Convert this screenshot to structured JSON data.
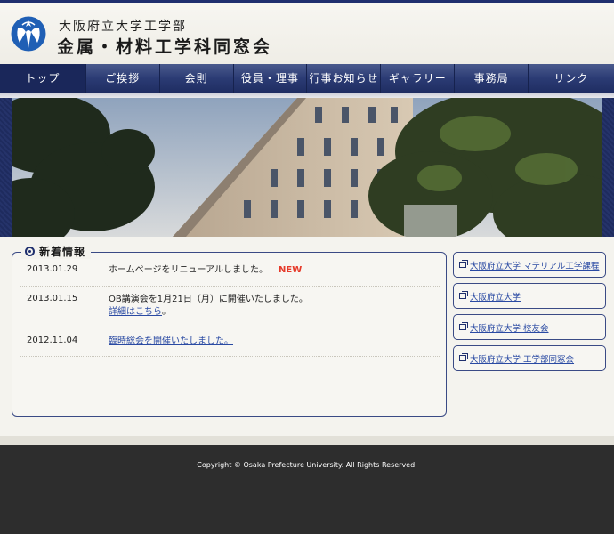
{
  "header": {
    "university": "大阪府立大学工学部",
    "title": "金属・材料工学科同窓会"
  },
  "nav": {
    "items": [
      {
        "label": "トップ"
      },
      {
        "label": "ご挨拶"
      },
      {
        "label": "会則"
      },
      {
        "label": "役員・理事"
      },
      {
        "label": "行事お知らせ"
      },
      {
        "label": "ギャラリー"
      },
      {
        "label": "事務局"
      },
      {
        "label": "リンク"
      }
    ]
  },
  "news": {
    "heading": "新着情報",
    "items": [
      {
        "date": "2013.01.29",
        "text": "ホームページをリニューアルしました。",
        "badge": "NEW"
      },
      {
        "date": "2013.01.15",
        "text": "OB講演会を1月21日（月）に開催いたしました。",
        "link": "詳細はこちら",
        "suffix": "。"
      },
      {
        "date": "2012.11.04",
        "link": "臨時総会を開催いたしました。"
      }
    ]
  },
  "side_links": [
    {
      "label": "大阪府立大学 マテリアル工学課程"
    },
    {
      "label": "大阪府立大学"
    },
    {
      "label": "大阪府立大学 校友会"
    },
    {
      "label": "大阪府立大学 工学部同窓会"
    }
  ],
  "footer": {
    "copyright": "Copyright © Osaka Prefecture University. All Rights Reserved."
  },
  "colors": {
    "brand_navy": "#1f2f6e",
    "link_blue": "#2a4aa3",
    "new_badge": "#e63a2a",
    "footer_bg": "#2d2d2d"
  }
}
